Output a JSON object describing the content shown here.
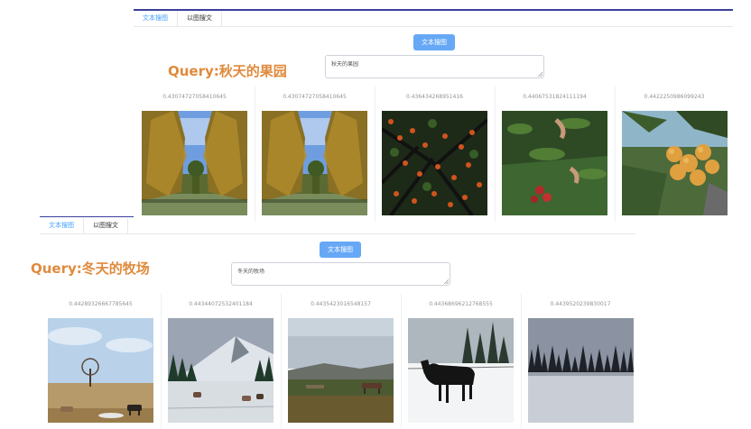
{
  "tabs": {
    "text_search": "文本搜图",
    "image_search": "以图搜文"
  },
  "search_button": "文本搜图",
  "section1": {
    "query_label": "Query:秋天的果园",
    "input_value": "秋天的果园",
    "scores": [
      "0.43074727058410645",
      "0.43074727058410645",
      "0.436434268951416",
      "0.44067531824111194",
      "0.4422250986099243"
    ]
  },
  "section2": {
    "query_label": "Query:冬天的牧场",
    "input_value": "冬天的牧场",
    "scores": [
      "0.44289326667785645",
      "0.44344072532401184",
      "0.4435423016548157",
      "0.44368696212768555",
      "0.4439520239830017"
    ]
  },
  "icons": [
    "textarea-resize-icon"
  ],
  "colors": {
    "accent": "#409eff",
    "button": "#66a8f5",
    "query": "#e08a3c",
    "topline": "#3a3f9c"
  }
}
